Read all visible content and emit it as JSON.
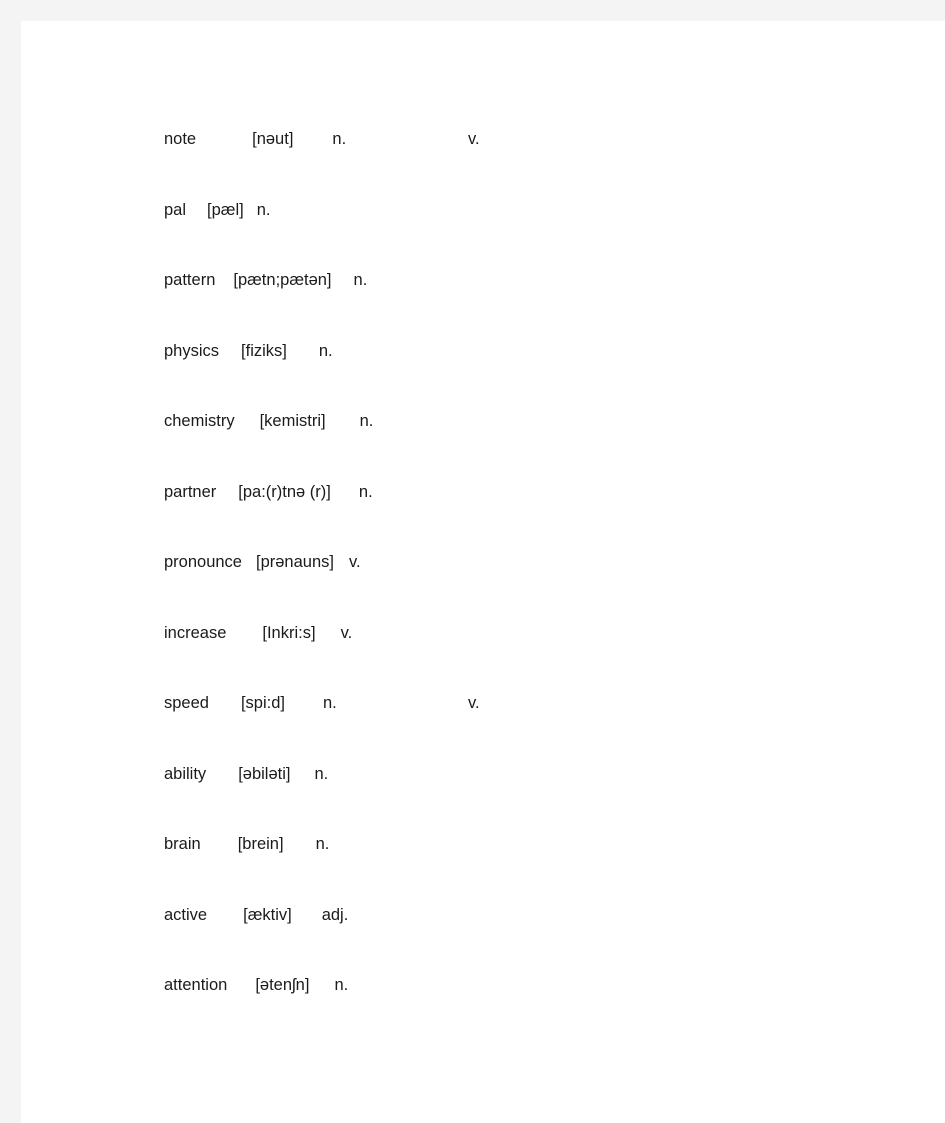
{
  "document": {
    "background_color": "#f4f4f4",
    "page_color": "#ffffff",
    "text_color": "#1b1b1b",
    "entries": [
      {
        "word": "note",
        "phonetic": "[nəut]",
        "pos1": "n.",
        "pos2": "v.",
        "word_gap": 56,
        "phonetic_gap": 39
      },
      {
        "word": "pal",
        "phonetic": "[pæl]",
        "pos1": "n.",
        "pos2": "",
        "word_gap": 21,
        "phonetic_gap": 13
      },
      {
        "word": "pattern",
        "phonetic": "[pætn;pætən]",
        "pos1": "n.",
        "pos2": "",
        "word_gap": 18,
        "phonetic_gap": 22
      },
      {
        "word": "physics",
        "phonetic": "[fiziks]",
        "pos1": "n.",
        "pos2": "",
        "word_gap": 22,
        "phonetic_gap": 32
      },
      {
        "word": "chemistry",
        "phonetic": "[kemistri]",
        "pos1": "n.",
        "pos2": "",
        "word_gap": 25,
        "phonetic_gap": 34
      },
      {
        "word": "partner",
        "phonetic": "[pa:(r)tnə (r)]",
        "pos1": "n.",
        "pos2": "",
        "word_gap": 22,
        "phonetic_gap": 28
      },
      {
        "word": "pronounce",
        "phonetic": "[prənauns]",
        "pos1": "v.",
        "pos2": "",
        "word_gap": 14,
        "phonetic_gap": 15
      },
      {
        "word": "increase",
        "phonetic": "[Inkri:s]",
        "pos1": "v.",
        "pos2": "",
        "word_gap": 36,
        "phonetic_gap": 25
      },
      {
        "word": "speed",
        "phonetic": "[spi:d]",
        "pos1": "n.",
        "pos2": "v.",
        "word_gap": 32,
        "phonetic_gap": 38
      },
      {
        "word": "ability",
        "phonetic": "[əbiləti]",
        "pos1": "n.",
        "pos2": "",
        "word_gap": 32,
        "phonetic_gap": 24
      },
      {
        "word": "brain",
        "phonetic": "[brein]",
        "pos1": "n.",
        "pos2": "",
        "word_gap": 37,
        "phonetic_gap": 32
      },
      {
        "word": "active",
        "phonetic": "[æktiv]",
        "pos1": "adj.",
        "pos2": "",
        "word_gap": 36,
        "phonetic_gap": 30
      },
      {
        "word": "attention",
        "phonetic": "[ətenʃn]",
        "pos1": "n.",
        "pos2": "",
        "word_gap": 28,
        "phonetic_gap": 25
      }
    ]
  }
}
